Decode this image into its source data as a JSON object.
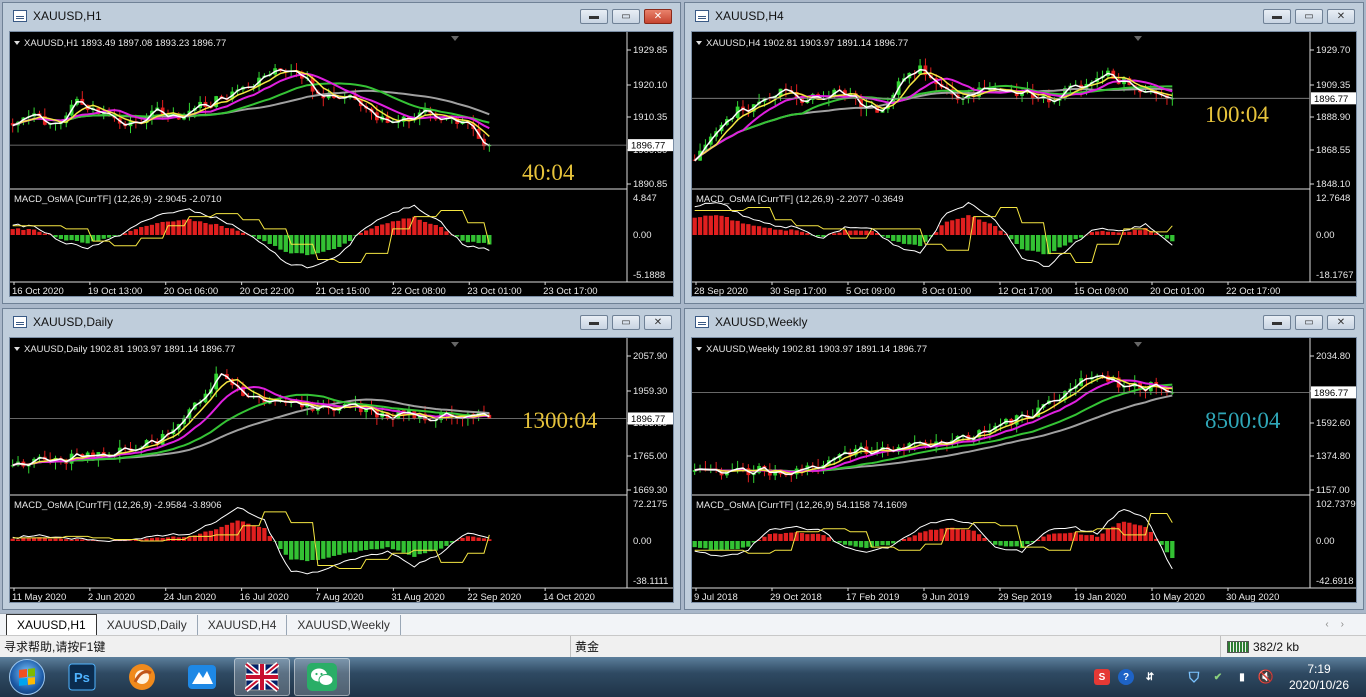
{
  "windows": [
    {
      "id": "h1",
      "title": "XAUUSD,H1",
      "chart_info": "XAUUSD,H1  1893.49 1897.08 1893.23 1896.77",
      "macd_label": "MACD_OsMA [CurrTF] (12,26,9) -2.9045 -2.0710",
      "price_ticks": [
        "1929.85",
        "1920.10",
        "1910.35",
        "1900.60",
        "1890.85"
      ],
      "current_price": "1896.77",
      "macd_ticks": [
        "4.847",
        "0.00",
        "-5.1888"
      ],
      "time_labels": [
        "16 Oct 2020",
        "19 Oct 13:00",
        "20 Oct 06:00",
        "20 Oct 22:00",
        "21 Oct 15:00",
        "22 Oct 08:00",
        "23 Oct 01:00",
        "23 Oct 17:00"
      ],
      "timer": "40:04",
      "timer_color": "#e6c33b",
      "active": true
    },
    {
      "id": "h4",
      "title": "XAUUSD,H4",
      "chart_info": "XAUUSD,H4  1902.81 1903.97 1891.14 1896.77",
      "macd_label": "MACD_OsMA [CurrTF] (12,26,9) -2.2077 -0.3649",
      "price_ticks": [
        "1929.70",
        "1909.35",
        "1888.90",
        "1868.55",
        "1848.10"
      ],
      "current_price": "1896.77",
      "macd_ticks": [
        "12.7648",
        "0.00",
        "-18.1767"
      ],
      "time_labels": [
        "28 Sep 2020",
        "30 Sep 17:00",
        "5 Oct 09:00",
        "8 Oct 01:00",
        "12 Oct 17:00",
        "15 Oct 09:00",
        "20 Oct 01:00",
        "22 Oct 17:00"
      ],
      "timer": "100:04",
      "timer_color": "#e6c33b",
      "active": false
    },
    {
      "id": "d1",
      "title": "XAUUSD,Daily",
      "chart_info": "XAUUSD,Daily  1902.81 1903.97 1891.14 1896.77",
      "macd_label": "MACD_OsMA [CurrTF] (12,26,9) -2.9584 -3.8906",
      "price_ticks": [
        "2057.90",
        "1959.30",
        "1863.60",
        "1765.00",
        "1669.30"
      ],
      "current_price": "1896.77",
      "macd_ticks": [
        "72.2175",
        "0.00",
        "-38.1111"
      ],
      "time_labels": [
        "11 May 2020",
        "2 Jun 2020",
        "24 Jun 2020",
        "16 Jul 2020",
        "7 Aug 2020",
        "31 Aug 2020",
        "22 Sep 2020",
        "14 Oct 2020"
      ],
      "timer": "1300:04",
      "timer_color": "#e6c33b",
      "active": false
    },
    {
      "id": "w1",
      "title": "XAUUSD,Weekly",
      "chart_info": "XAUUSD,Weekly  1902.81 1903.97 1891.14 1896.77",
      "macd_label": "MACD_OsMA [CurrTF] (12,26,9) 54.1158 74.1609",
      "price_ticks": [
        "2034.80",
        "1817.00",
        "1592.60",
        "1374.80",
        "1157.00"
      ],
      "current_price": "1896.77",
      "macd_ticks": [
        "102.7379",
        "0.00",
        "-42.6918"
      ],
      "time_labels": [
        "9 Jul 2018",
        "29 Oct 2018",
        "17 Feb 2019",
        "9 Jun 2019",
        "29 Sep 2019",
        "19 Jan 2020",
        "10 May 2020",
        "30 Aug 2020"
      ],
      "timer": "8500:04",
      "timer_color": "#2fa7b8",
      "active": false
    }
  ],
  "tabs": [
    "XAUUSD,H1",
    "XAUUSD,Daily",
    "XAUUSD,H4",
    "XAUUSD,Weekly"
  ],
  "active_tab": 0,
  "status": {
    "help_text": "寻求帮助,请按F1键",
    "profile": "黄金",
    "traffic": "382/2 kb"
  },
  "taskbar": {
    "apps": [
      "start-button",
      "photoshop",
      "browser",
      "task-app",
      "mt4-terminal",
      "wechat"
    ],
    "time": "7:19",
    "date": "2020/10/26"
  }
}
